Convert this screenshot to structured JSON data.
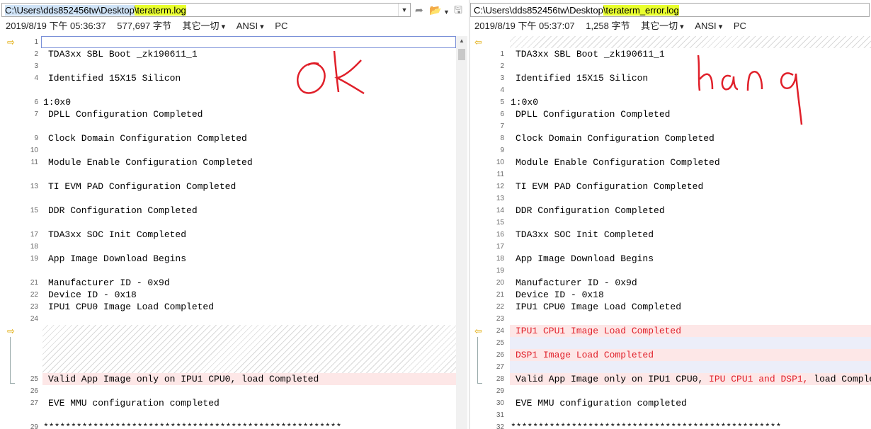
{
  "left": {
    "path_prefix": "C:\\Users\\dds852456tw\\Desktop",
    "path_file": "\\teraterm.log",
    "date": "2019/8/19 下午 05:36:37",
    "size": "577,697 字节",
    "filter": "其它一切",
    "encoding": "ANSI",
    "eol": "PC",
    "annotation": "ok"
  },
  "right": {
    "path_prefix": "C:\\Users\\dds852456tw\\Desktop",
    "path_file": "\\teraterm_error.log",
    "date": "2019/8/19 下午 05:37:07",
    "size": "1,258 字节",
    "filter": "其它一切",
    "encoding": "ANSI",
    "eol": "PC",
    "annotation": "hang"
  },
  "lines": {
    "sbl": "TDA3xx SBL Boot _zk190611_1",
    "silicon": "Identified 15X15 Silicon",
    "hex": "1:0x0",
    "dpll": "DPLL Configuration Completed",
    "clock": "Clock Domain Configuration Completed",
    "module": "Module Enable Configuration Completed",
    "pad": "TI EVM PAD Configuration Completed",
    "ddr": "DDR Configuration Completed",
    "soc": "TDA3xx SOC Init Completed",
    "app": "App Image Download Begins",
    "mfr": "Manufacturer ID - 0x9d",
    "dev": "Device ID - 0x18",
    "ipu0": "IPU1 CPU0 Image Load Completed",
    "ipu1": "IPU1 CPU1 Image Load Completed",
    "dsp1": "DSP1 Image Load Completed",
    "valid_left": "Valid App Image only on IPU1 CPU0, load Completed",
    "valid_right_a": "Valid App Image only on IPU1 CPU0, ",
    "valid_right_b": "IPU CPU1 and DSP1,",
    "valid_right_c": " load Completed",
    "eve": "EVE MMU configuration completed",
    "stars_left": "******************************************************",
    "stars_right": "*************************************************"
  },
  "lnums_left": [
    "1",
    "2",
    "3",
    "4",
    "6",
    "7",
    "9",
    "10",
    "11",
    "13",
    "15",
    "17",
    "18",
    "19",
    "21",
    "22",
    "23",
    "24",
    "25",
    "26",
    "27",
    "29"
  ],
  "lnums_right": [
    "1",
    "2",
    "3",
    "4",
    "5",
    "6",
    "7",
    "8",
    "9",
    "10",
    "11",
    "12",
    "13",
    "14",
    "15",
    "16",
    "17",
    "18",
    "19",
    "20",
    "21",
    "22",
    "23",
    "24",
    "25",
    "26",
    "27",
    "28",
    "29",
    "30",
    "31",
    "32"
  ],
  "colors": {
    "diff_red": "#e0202a",
    "diff_bg": "#fde7e7",
    "path_highlight": "#e9ff2e",
    "arrow": "#e0a800"
  }
}
